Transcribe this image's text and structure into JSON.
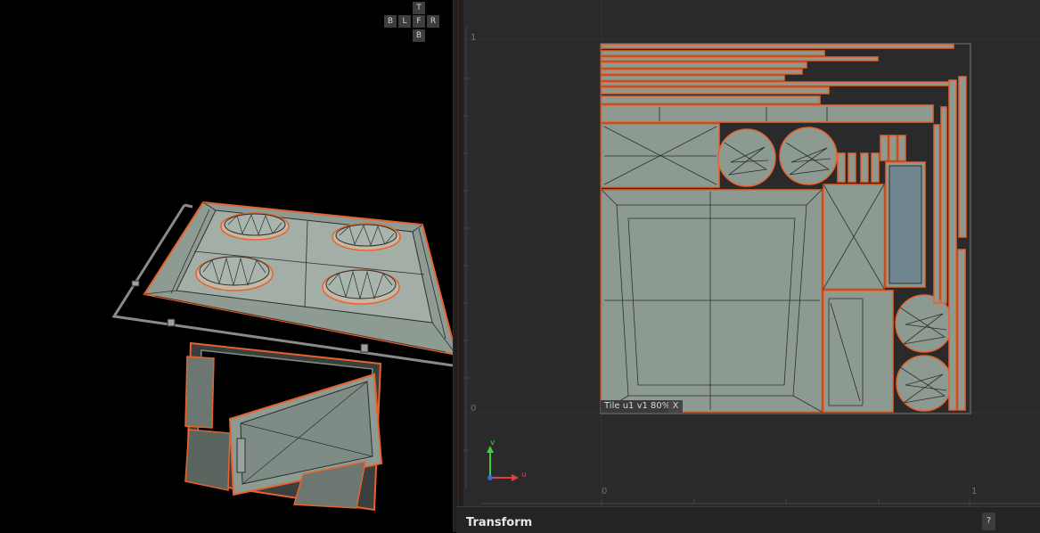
{
  "nav_cube": {
    "top": "T",
    "back": "B",
    "left": "L",
    "front": "F",
    "right": "R",
    "bottom": "B"
  },
  "uv_editor": {
    "tick_left_top": "1",
    "tick_left_bottom": "0",
    "tick_bottom_left": "0",
    "tick_bottom_right": "1",
    "tile_label": "Tile u1  v1  80%",
    "tile_close": "X",
    "axis_v": "v",
    "axis_u": "u"
  },
  "bottom_bar": {
    "title": "Transform",
    "help": "?"
  },
  "colors": {
    "uv_fill": "#8d9a92",
    "edge": "#e8622d",
    "wire": "#2b2f2d",
    "selected_fill": "#6f8590",
    "background": "#2a2a2a"
  }
}
